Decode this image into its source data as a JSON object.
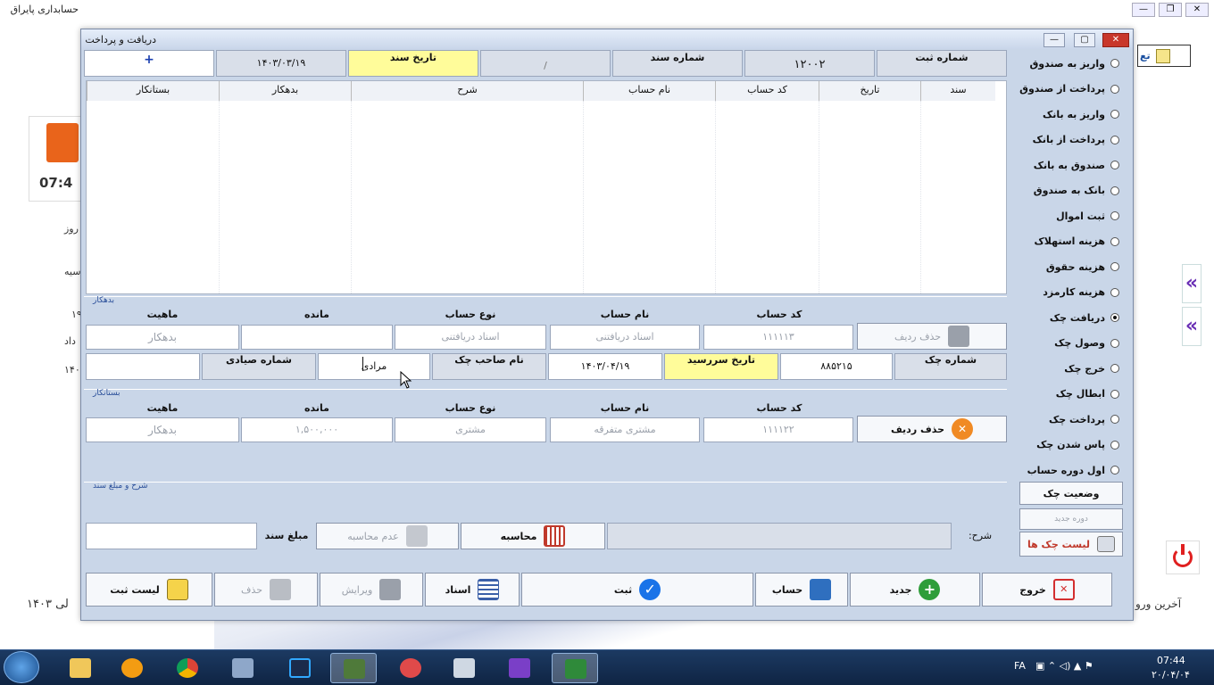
{
  "background_app": {
    "title": "حسابداری پایراق",
    "time_display": "07:4",
    "side_labels": [
      "روز",
      "سیه",
      "۱۹",
      "داد",
      "۱۴۰"
    ],
    "bottom_right_text": "آخرین ورو",
    "bottom_left_text": "لی ۱۴۰۳",
    "top_right_fragment": "تع",
    "win_buttons": [
      "—",
      "❐",
      "✕"
    ]
  },
  "dialog": {
    "title": "دریافت و پرداخت",
    "title_buttons": [
      "—",
      "▢",
      "✕"
    ],
    "header": {
      "add_symbol": "+",
      "doc_date_value": "۱۴۰۳/۰۳/۱۹",
      "doc_date_label": "تاریخ سند",
      "doc_number_value": "/",
      "doc_number_label": "شماره سند",
      "reg_number_value": "۱۲۰۰۲",
      "reg_number_label": "شماره ثبت"
    },
    "grid": {
      "columns": [
        "سند",
        "تاریخ",
        "کد حساب",
        "نام حساب",
        "شرح",
        "بدهکار",
        "بستانکار"
      ],
      "rows": []
    },
    "debtor": {
      "section_title": "بدهکار",
      "labels": {
        "account_code": "کد حساب",
        "account_name": "نام حساب",
        "account_type": "نوع حساب",
        "balance": "مانده",
        "nature": "ماهیت"
      },
      "values": {
        "account_code": "۱۱۱۱۱۳",
        "account_name": "اسناد دریافتنی",
        "account_type": "اسناد دریافتنی",
        "balance": "",
        "nature": "بدهکار"
      },
      "delete_row_label": "حذف ردیف",
      "cheque": {
        "number_label": "شماره چک",
        "number_value": "۸۸۵۲۱۵",
        "due_date_label": "تاریخ سررسید",
        "due_date_value": "۱۴۰۳/۰۴/۱۹",
        "owner_label": "نام صاحب چک",
        "owner_value": "مرادی",
        "sayadi_label": "شماره صیادی",
        "sayadi_value": ""
      }
    },
    "creditor": {
      "section_title": "بستانکار",
      "labels": {
        "account_code": "کد حساب",
        "account_name": "نام حساب",
        "account_type": "نوع حساب",
        "balance": "مانده",
        "nature": "ماهیت"
      },
      "values": {
        "account_code": "۱۱۱۱۲۲",
        "account_name": "مشتری متفرقه",
        "account_type": "مشتری",
        "balance": "۱,۵۰۰,۰۰۰",
        "nature": "بدهکار"
      },
      "delete_row_label": "حذف ردیف"
    },
    "description": {
      "section_title": "شرح و مبلغ سند",
      "desc_label": "شرح:",
      "desc_value": "",
      "calc_label": "محاسبه",
      "no_calc_label": "عدم محاسبه",
      "amount_label": "مبلغ سند",
      "amount_value": ""
    },
    "options": [
      {
        "label": "واریز به صندوق",
        "selected": false
      },
      {
        "label": "پرداخت از صندوق",
        "selected": false
      },
      {
        "label": "واریز به بانک",
        "selected": false
      },
      {
        "label": "پرداخت از بانک",
        "selected": false
      },
      {
        "label": "صندوق به بانک",
        "selected": false
      },
      {
        "label": "بانک به صندوق",
        "selected": false
      },
      {
        "label": "ثبت اموال",
        "selected": false
      },
      {
        "label": "هزینه استهلاک",
        "selected": false
      },
      {
        "label": "هزینه حقوق",
        "selected": false
      },
      {
        "label": "هزینه کارمزد",
        "selected": false
      },
      {
        "label": "دریافت چک",
        "selected": true
      },
      {
        "label": "وصول چک",
        "selected": false
      },
      {
        "label": "خرج چک",
        "selected": false
      },
      {
        "label": "ابطال چک",
        "selected": false
      },
      {
        "label": "پرداخت چک",
        "selected": false
      },
      {
        "label": "پاس شدن چک",
        "selected": false
      },
      {
        "label": "اول دوره حساب",
        "selected": false
      }
    ],
    "cheque_status_label": "وضعیت چک",
    "cheque_faded_label": "دوره جدید",
    "cheque_list_label": "لیست چک ها",
    "buttons": {
      "exit": "خروج",
      "new": "جدید",
      "account": "حساب",
      "save": "ثبت",
      "documents": "اسناد",
      "edit": "ویرایش",
      "delete": "حذف",
      "save_list": "لیست ثبت"
    }
  },
  "taskbar": {
    "lang": "FA",
    "time": "07:44",
    "date": "۲۰/۰۴/۰۴"
  },
  "colors": {
    "dialog_bg": "#c9d6e8",
    "yellow_field": "#fffc9a",
    "accent_blue": "#1a73e8",
    "close_red": "#c8372b"
  }
}
